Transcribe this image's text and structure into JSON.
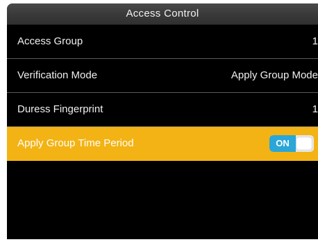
{
  "title": "Access Control",
  "menu": [
    {
      "label": "Access Group",
      "value": "1"
    },
    {
      "label": "Verification Mode",
      "value": "Apply Group Mode"
    },
    {
      "label": "Duress Fingerprint",
      "value": "1"
    },
    {
      "label": "Apply Group Time Period",
      "toggle_label": "ON",
      "toggle_state": "on"
    }
  ],
  "colors": {
    "selected_row": "#f3b314",
    "toggle_on": "#2aa6d8",
    "background": "#000000"
  }
}
